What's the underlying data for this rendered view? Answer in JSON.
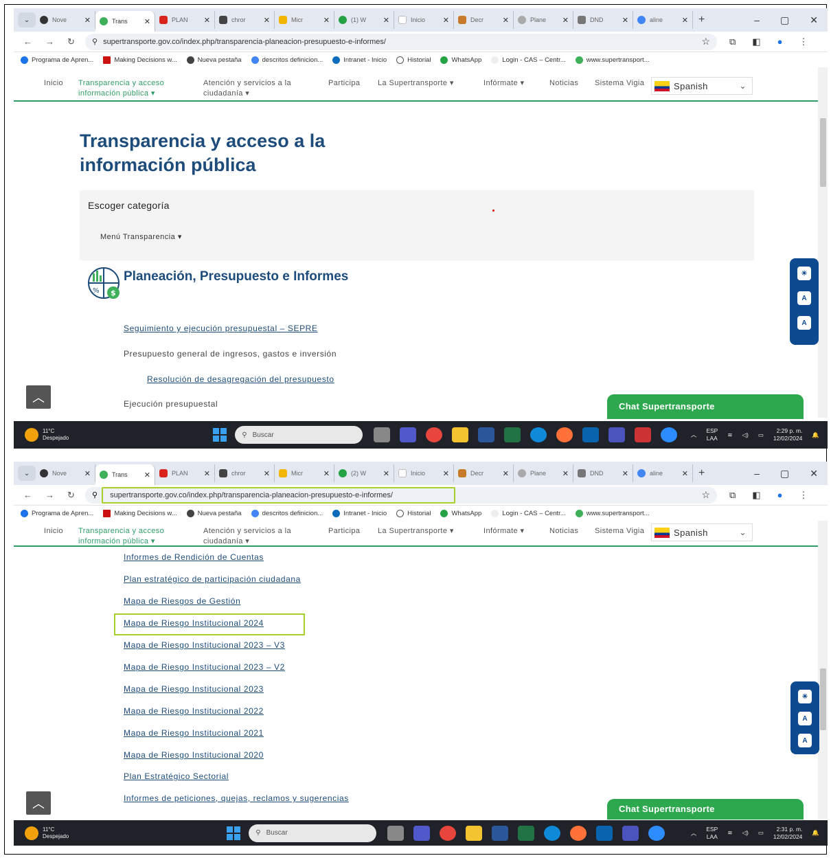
{
  "browser": {
    "tabs": [
      "Nove",
      "Trans",
      "PLAN",
      "chror",
      "Micr",
      "(1) W",
      "Inicio",
      "Decr",
      "Plane",
      "DND",
      "aline"
    ],
    "tabs_second": [
      "Nove",
      "Trans",
      "PLAN",
      "chror",
      "Micr",
      "(2) W",
      "Inicio",
      "Decr",
      "Plane",
      "DND",
      "aline"
    ],
    "url": "supertransporte.gov.co/index.php/transparencia-planeacion-presupuesto-e-informes/",
    "bookmarks": [
      "Programa de Apren...",
      "Making Decisions w...",
      "Nueva pestaña",
      "descritos definicion...",
      "Intranet - Inicio",
      "Historial",
      "WhatsApp",
      "Login - CAS – Centr...",
      "www.supertransport..."
    ]
  },
  "site_nav": {
    "inicio": "Inicio",
    "transparencia_1": "Transparencia y acceso",
    "transparencia_2": "información pública  ▾",
    "atencion_1": "Atención y servicios a la",
    "atencion_2": "ciudadanía  ▾",
    "participa": "Participa",
    "supertransporte": "La Supertransporte  ▾",
    "informate": "Infórmate  ▾",
    "noticias": "Noticias",
    "sistema": "Sistema Vigia",
    "language": "Spanish"
  },
  "page": {
    "title_line1": "Transparencia y acceso a la",
    "title_line2": "información pública",
    "category_label": "Escoger categoría",
    "menu_label": "Menú Transparencia  ▾",
    "section_title": "Planeación, Presupuesto e Informes",
    "links_top": {
      "sepre": "Seguimiento y ejecución presupuestal – SEPRE",
      "presupuesto": "Presupuesto general de ingresos, gastos e inversión",
      "resolucion": "Resolución de desagregación del presupuesto",
      "ejecucion": "Ejecución presupuestal"
    },
    "links_bottom": [
      "Informes de Rendición de Cuentas",
      "Plan estratégico de participación ciudadana",
      "Mapa de Riesgos de Gestión",
      "Mapa de Riesgo Institucional 2024",
      "Mapa de Riesgo Institucional 2023 – V3",
      "Mapa de Riesgo Institucional 2023 – V2",
      "Mapa de Riesgo Institucional 2023",
      "Mapa de Riesgo Institucional 2022",
      "Mapa de Riesgo Institucional 2021",
      "Mapa de Riesgo Institucional 2020",
      "Plan Estratégico Sectorial",
      "Informes de peticiones, quejas, reclamos y sugerencias"
    ],
    "chat": "Chat Supertransporte"
  },
  "taskbar": {
    "temp": "11°C",
    "weather": "Despejado",
    "search": "Buscar",
    "lang_1": "ESP",
    "lang_2": "LAA",
    "time_1": "2:29 p. m.",
    "time_2": "2:31 p. m.",
    "date": "12/02/2024"
  },
  "colors": {
    "accent_green": "#2e9c67",
    "title_blue": "#1d4c7a",
    "highlight": "#a8d02a",
    "chat_green": "#2ea84f"
  }
}
